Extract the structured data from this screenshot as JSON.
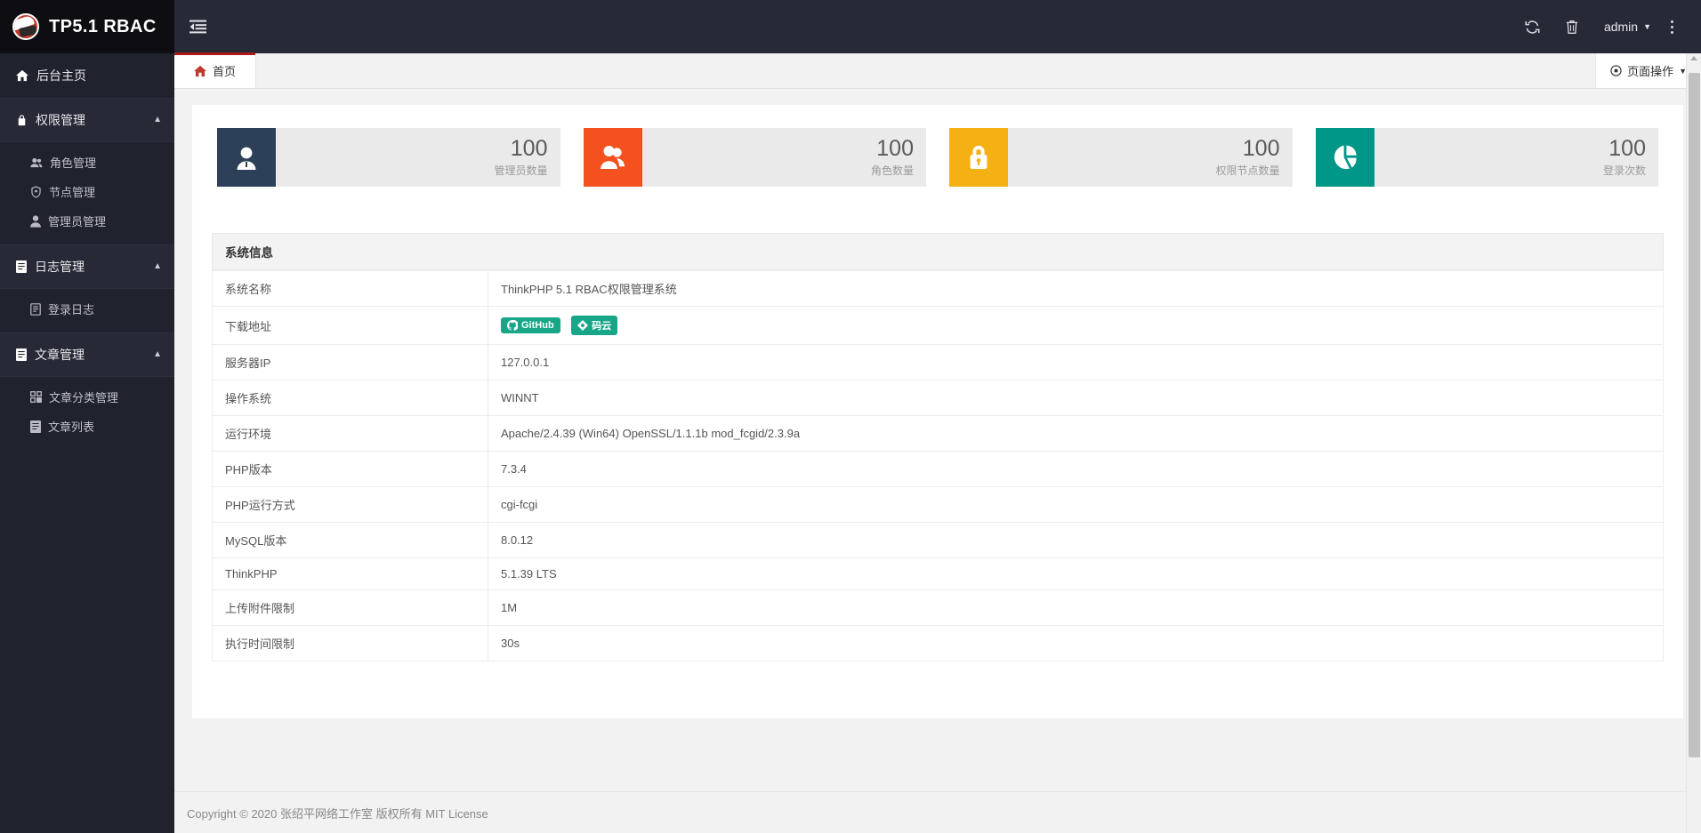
{
  "brand": {
    "logo_icon": "thinkphp-logo-icon",
    "title": "TP5.1 RBAC"
  },
  "sidebar": {
    "home": {
      "icon": "home-icon",
      "label": "后台主页"
    },
    "groups": [
      {
        "icon": "lock-icon",
        "label": "权限管理",
        "caret": "▲",
        "items": [
          {
            "icon": "users-icon",
            "label": "角色管理"
          },
          {
            "icon": "shield-icon",
            "label": "节点管理"
          },
          {
            "icon": "user-icon",
            "label": "管理员管理"
          }
        ]
      },
      {
        "icon": "file-text-icon",
        "label": "日志管理",
        "caret": "▲",
        "items": [
          {
            "icon": "book-icon",
            "label": "登录日志"
          }
        ]
      },
      {
        "icon": "file-text-icon",
        "label": "文章管理",
        "caret": "▲",
        "items": [
          {
            "icon": "grid-icon",
            "label": "文章分类管理"
          },
          {
            "icon": "file-icon",
            "label": "文章列表"
          }
        ]
      }
    ]
  },
  "topbar": {
    "toggle_icon": "menu-fold-icon",
    "refresh_icon": "refresh-icon",
    "trash_icon": "trash-icon",
    "user_name": "admin",
    "user_caret": "▼",
    "kebab_icon": "more-vertical-icon"
  },
  "tabbar": {
    "tabs": [
      {
        "icon": "home-icon",
        "label": "首页",
        "active": true
      }
    ],
    "page_action": {
      "icon": "target-icon",
      "label": "页面操作",
      "caret": "▼"
    }
  },
  "stats": [
    {
      "icon": "user-solid-icon",
      "value": "100",
      "label": "管理员数量",
      "color": "#2d4059"
    },
    {
      "icon": "users-solid-icon",
      "value": "100",
      "label": "角色数量",
      "color": "#f4511e"
    },
    {
      "icon": "lock-solid-icon",
      "value": "100",
      "label": "权限节点数量",
      "color": "#f5b014"
    },
    {
      "icon": "pie-chart-icon",
      "value": "100",
      "label": "登录次数",
      "color": "#009688"
    }
  ],
  "sysinfo": {
    "heading": "系统信息",
    "rows": [
      {
        "key": "系统名称",
        "value": "ThinkPHP 5.1 RBAC权限管理系统"
      },
      {
        "key": "下载地址",
        "value": "",
        "badges": [
          {
            "icon": "github-icon",
            "label": "GitHub",
            "color": "#18a689"
          },
          {
            "icon": "gitee-icon",
            "label": "码云",
            "color": "#18a689"
          }
        ]
      },
      {
        "key": "服务器IP",
        "value": "127.0.0.1"
      },
      {
        "key": "操作系统",
        "value": "WINNT"
      },
      {
        "key": "运行环境",
        "value": "Apache/2.4.39 (Win64) OpenSSL/1.1.1b mod_fcgid/2.3.9a"
      },
      {
        "key": "PHP版本",
        "value": "7.3.4"
      },
      {
        "key": "PHP运行方式",
        "value": "cgi-fcgi"
      },
      {
        "key": "MySQL版本",
        "value": "8.0.12"
      },
      {
        "key": "ThinkPHP",
        "value": "5.1.39 LTS"
      },
      {
        "key": "上传附件限制",
        "value": "1M"
      },
      {
        "key": "执行时间限制",
        "value": "30s"
      }
    ]
  },
  "footer": {
    "text": "Copyright © 2020 张绍平网络工作室 版权所有 MIT License"
  },
  "colors": {
    "sidebar_bg": "#20222e",
    "logo_bg": "#0d0d12",
    "topbar_bg": "#272936",
    "tab_accent": "#aa1919",
    "content_bg": "#f2f2f2"
  }
}
